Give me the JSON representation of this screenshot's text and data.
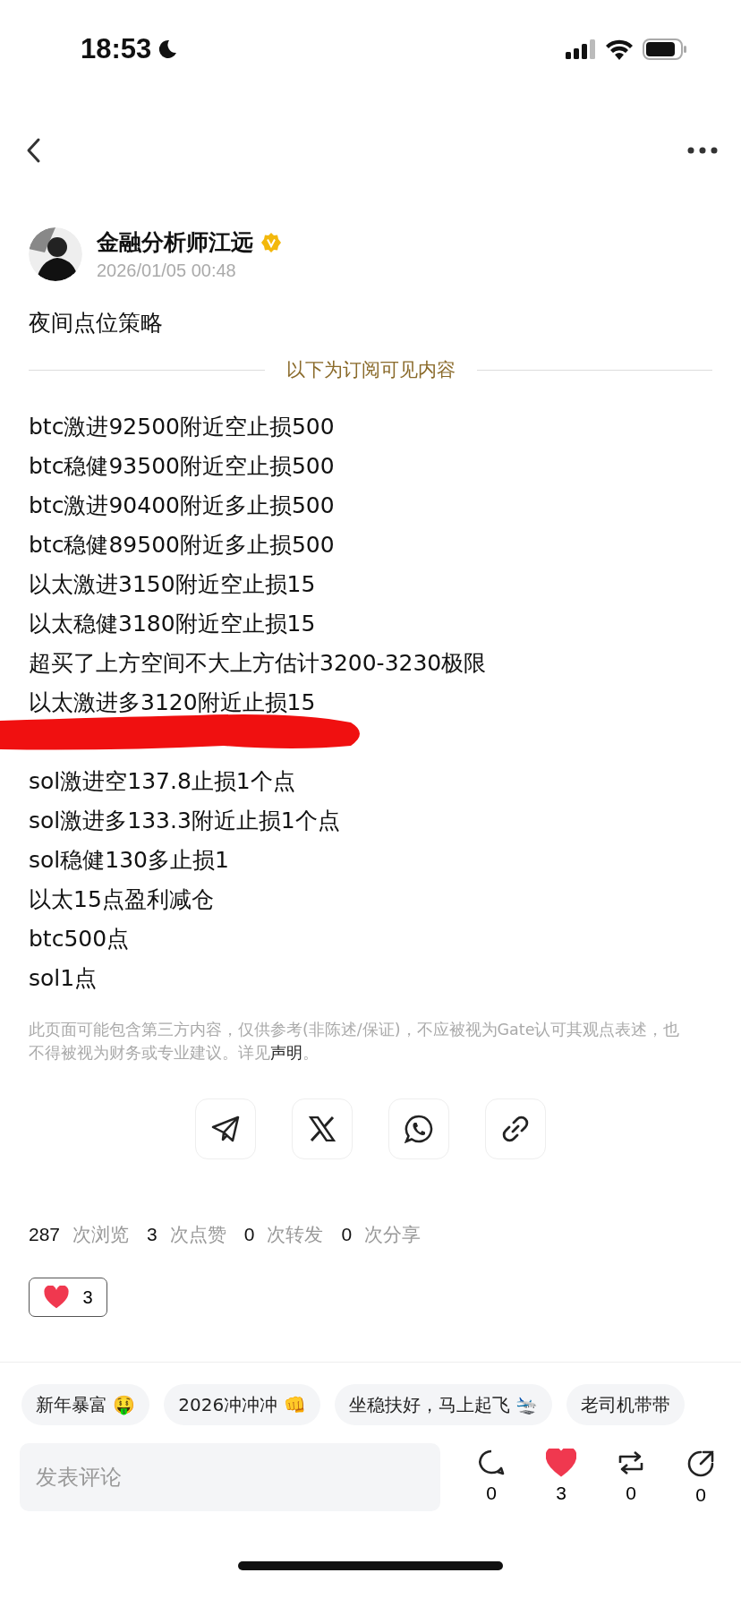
{
  "status_bar": {
    "time": "18:53"
  },
  "author": {
    "name": "金融分析师江远",
    "verified": true,
    "date": "2026/01/05 00:48"
  },
  "post": {
    "title": "夜间点位策略",
    "divider_label": "以下为订阅可见内容",
    "lines": [
      {
        "kind": "text",
        "text": "btc激进92500附近空止损500"
      },
      {
        "kind": "text",
        "text": "btc稳健93500附近空止损500"
      },
      {
        "kind": "text",
        "text": "btc激进90400附近多止损500"
      },
      {
        "kind": "text",
        "text": "btc稳健89500附近多止损500"
      },
      {
        "kind": "text",
        "text": "以太激进3150附近空止损15"
      },
      {
        "kind": "text",
        "text": "以太稳健3180附近空止损15"
      },
      {
        "kind": "text",
        "text": "超买了上方空间不大上方估计3200-3230极限"
      },
      {
        "kind": "text",
        "text": "以太激进多3120附近止损15"
      },
      {
        "kind": "redacted"
      },
      {
        "kind": "text",
        "text": "sol激进空137.8止损1个点"
      },
      {
        "kind": "text",
        "text": "sol激进多133.3附近止损1个点"
      },
      {
        "kind": "text",
        "text": "sol稳健130多止损1"
      },
      {
        "kind": "text",
        "text": "以太15点盈利减仓"
      },
      {
        "kind": "text",
        "text": "btc500点"
      },
      {
        "kind": "text",
        "text": "sol1点"
      }
    ],
    "disclaimer": "此页面可能包含第三方内容，仅供参考(非陈述/保证)，不应被视为Gate认可其观点表述，也不得被视为财务或专业建议。详见",
    "disclaimer_link": "声明",
    "disclaimer_end": "。"
  },
  "share_buttons": [
    {
      "kind": "telegram"
    },
    {
      "kind": "x"
    },
    {
      "kind": "whatsapp"
    },
    {
      "kind": "link"
    }
  ],
  "stats": [
    {
      "count": "287",
      "label": "次浏览"
    },
    {
      "count": "3",
      "label": "次点赞"
    },
    {
      "count": "0",
      "label": "次转发"
    },
    {
      "count": "0",
      "label": "次分享"
    }
  ],
  "reaction": {
    "count": "3"
  },
  "tags": [
    "新年暴富 🤑",
    "2026冲冲冲 👊",
    "坐稳扶好，马上起飞 🛬",
    "老司机带带"
  ],
  "comment": {
    "placeholder": "发表评论"
  },
  "actions": [
    {
      "kind": "comment",
      "count": "0",
      "selected": false
    },
    {
      "kind": "like",
      "count": "3",
      "selected": true
    },
    {
      "kind": "repost",
      "count": "0",
      "selected": false
    },
    {
      "kind": "share",
      "count": "0",
      "selected": false
    }
  ]
}
